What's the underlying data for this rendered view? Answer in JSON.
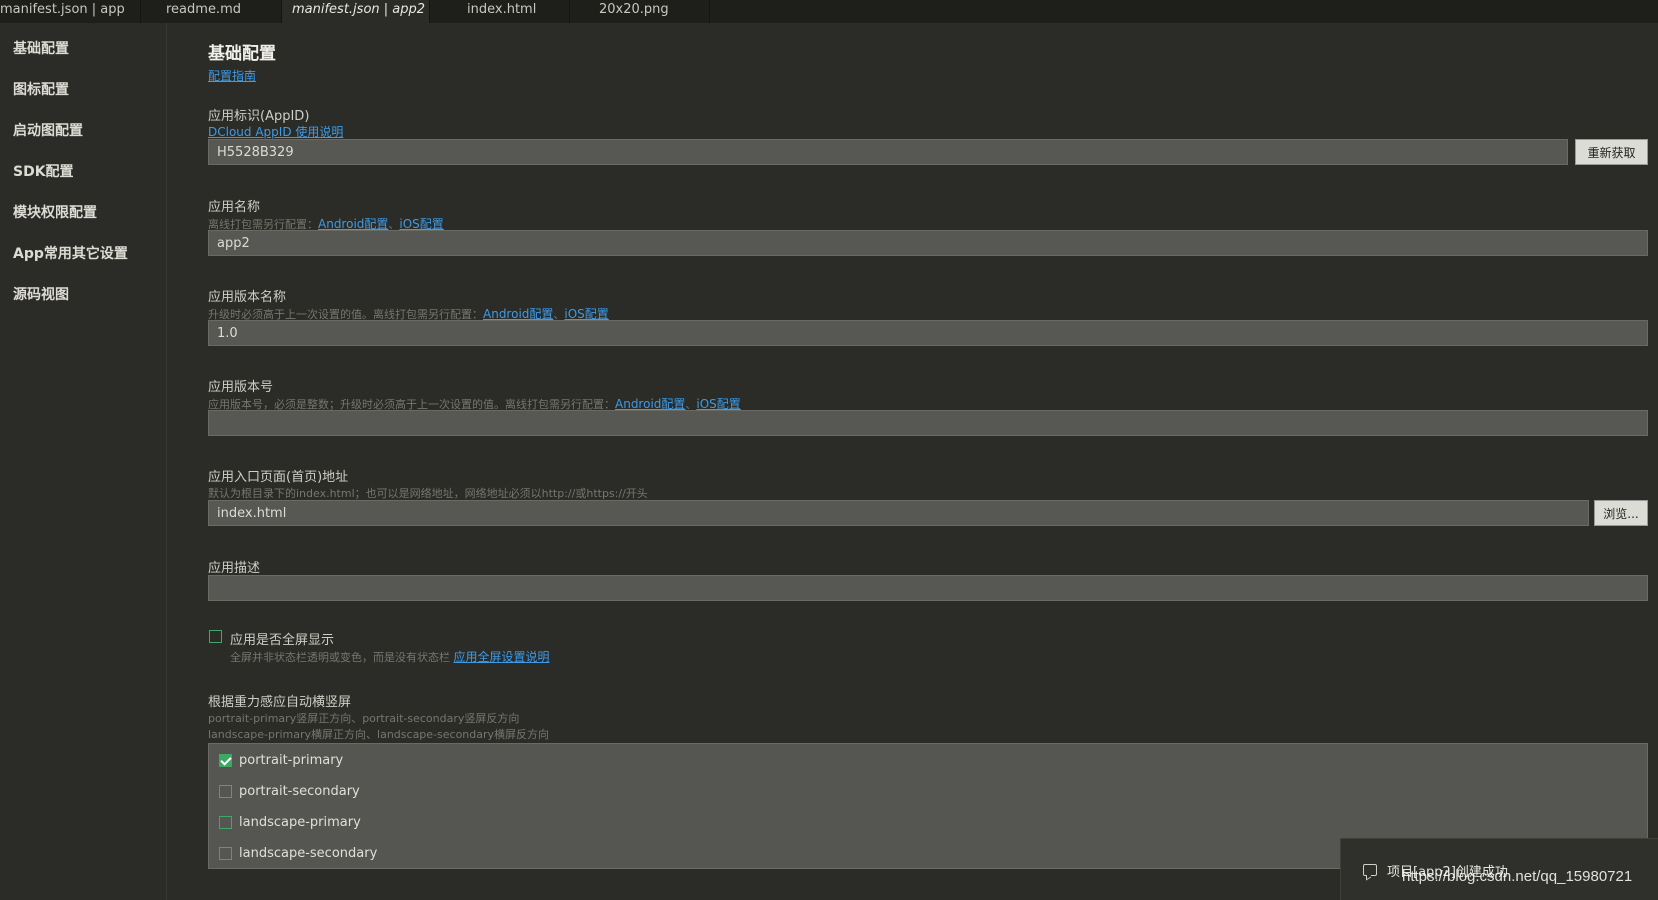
{
  "tabs": [
    {
      "label": "manifest.json | app",
      "active": false
    },
    {
      "label": "readme.md",
      "active": false
    },
    {
      "label": "manifest.json | app2",
      "active": true
    },
    {
      "label": "index.html",
      "active": false
    },
    {
      "label": "20x20.png",
      "active": false
    }
  ],
  "sidebar": {
    "items": [
      {
        "label": "基础配置"
      },
      {
        "label": "图标配置"
      },
      {
        "label": "启动图配置"
      },
      {
        "label": "SDK配置"
      },
      {
        "label": "模块权限配置"
      },
      {
        "label": "App常用其它设置"
      },
      {
        "label": "源码视图"
      }
    ]
  },
  "main": {
    "title": "基础配置",
    "guide_link": "配置指南",
    "appid": {
      "label": "应用标识(AppID)",
      "help_link": "DCloud AppID 使用说明",
      "value": "H5528B329",
      "button": "重新获取"
    },
    "name": {
      "label": "应用名称",
      "hint": "离线打包需另行配置：",
      "android_link": "Android配置",
      "sep": "、",
      "ios_link": "iOS配置",
      "value": "app2"
    },
    "version_name": {
      "label": "应用版本名称",
      "hint": "升级时必须高于上一次设置的值。离线打包需另行配置：",
      "android_link": "Android配置",
      "sep": "、",
      "ios_link": "iOS配置",
      "value": "1.0"
    },
    "version_code": {
      "label": "应用版本号",
      "hint": "应用版本号，必须是整数；升级时必须高于上一次设置的值。离线打包需另行配置：",
      "android_link": "Android配置",
      "sep": "、",
      "ios_link": "iOS配置",
      "value": ""
    },
    "entry": {
      "label": "应用入口页面(首页)地址",
      "hint": "默认为根目录下的index.html；也可以是网络地址，网络地址必须以http://或https://开头",
      "value": "index.html",
      "button": "浏览..."
    },
    "description": {
      "label": "应用描述",
      "value": ""
    },
    "fullscreen": {
      "label": "应用是否全屏显示",
      "hint": "全屏并非状态栏透明或变色，而是没有状态栏",
      "link": "应用全屏设置说明",
      "checked": false
    },
    "orientation": {
      "label": "根据重力感应自动横竖屏",
      "hint1": "portrait-primary竖屏正方向、portrait-secondary竖屏反方向",
      "hint2": "landscape-primary横屏正方向、landscape-secondary横屏反方向",
      "options": [
        {
          "label": "portrait-primary",
          "checked": true
        },
        {
          "label": "portrait-secondary",
          "checked": false
        },
        {
          "label": "landscape-primary",
          "checked": false
        },
        {
          "label": "landscape-secondary",
          "checked": false
        }
      ]
    }
  },
  "toast": {
    "message": "项目[app2]创建成功"
  },
  "watermark": "https://blog.csdn.net/qq_15980721",
  "colors": {
    "background": "#2b2b27",
    "link": "#3d9be8",
    "checkbox": "#3fa866",
    "input_bg": "#575753"
  }
}
